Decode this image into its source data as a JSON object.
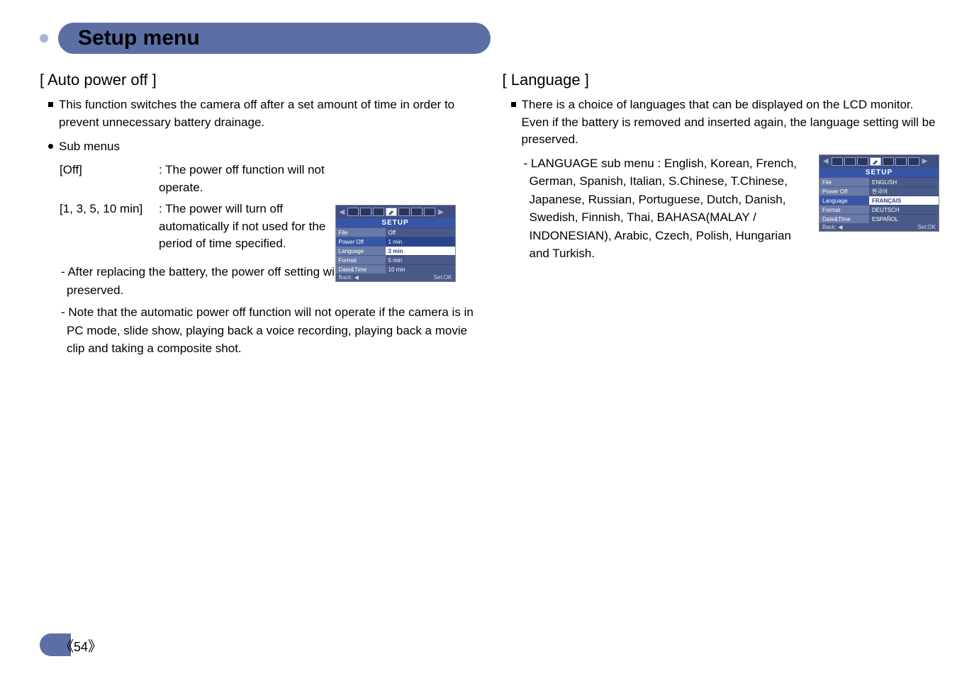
{
  "page_title": "Setup menu",
  "page_number": "54",
  "left": {
    "heading": "[ Auto power off ]",
    "intro": "This function switches the camera off after a set amount of time in order to prevent unnecessary battery drainage.",
    "submenus_label": "Sub menus",
    "sub1_key": "[Off]",
    "sub1_desc": ": The power off function will not operate.",
    "sub2_key": "[1, 3, 5, 10 min]",
    "sub2_desc": ": The power will turn off automatically if not used for the period of time specified.",
    "note1": "- After replacing the battery, the power off setting will be preserved.",
    "note2": "- Note that the automatic power off function will not operate if the camera is in PC mode, slide show, playing back a voice recording, playing back a movie clip and taking a composite shot."
  },
  "right": {
    "heading": "[ Language ]",
    "intro": "There is a choice of languages that can be displayed on the LCD monitor. Even if the battery is removed and inserted again, the language setting will be preserved.",
    "langs": "- LANGUAGE sub menu : English, Korean, French, German, Spanish, Italian, S.Chinese, T.Chinese, Japanese, Russian, Portuguese, Dutch, Danish, Swedish, Finnish, Thai, BAHASA(MALAY / INDONESIAN), Arabic, Czech, Polish, Hungarian and Turkish."
  },
  "ui_left": {
    "title": "SETUP",
    "rows": [
      {
        "l": "File",
        "r": "Off"
      },
      {
        "l": "Power Off",
        "r": "1 min"
      },
      {
        "l": "Language",
        "r": "3 min"
      },
      {
        "l": "Format",
        "r": "5 min"
      },
      {
        "l": "Date&Time",
        "r": "10 min"
      }
    ],
    "foot_l": "Back: ◀",
    "foot_r": "Set:OK"
  },
  "ui_right": {
    "title": "SETUP",
    "rows": [
      {
        "l": "File",
        "r": "ENGLISH"
      },
      {
        "l": "Power Off",
        "r": "한국어"
      },
      {
        "l": "Language",
        "r": "FRANÇAIS"
      },
      {
        "l": "Format",
        "r": "DEUTSCH"
      },
      {
        "l": "Date&Time",
        "r": "ESPAÑOL"
      }
    ],
    "foot_l": "Back: ◀",
    "foot_r": "Set:OK"
  }
}
